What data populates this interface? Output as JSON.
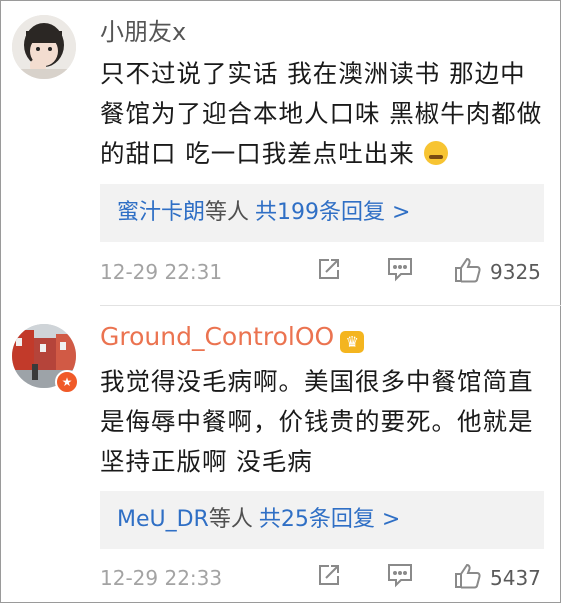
{
  "comments": [
    {
      "username": "小朋友x",
      "text": "只不过说了实话 我在澳洲读书 那边中餐馆为了迎合本地人口味 黑椒牛肉都做的甜口 吃一口我差点吐出来",
      "replies": {
        "users": "蜜汁卡朗",
        "suffix": "等人",
        "count": "共199条回复 >"
      },
      "timestamp": "12-29 22:31",
      "likes": "9325"
    },
    {
      "username": "Ground_ControlOO",
      "text": "我觉得没毛病啊。美国很多中餐馆简直是侮辱中餐啊，价钱贵的要死。他就是坚持正版啊 没毛病",
      "replies": {
        "users": "MeU_DR",
        "suffix": "等人",
        "count": "共25条回复 >"
      },
      "timestamp": "12-29 22:33",
      "likes": "5437"
    }
  ],
  "colors": {
    "link": "#2f6fc5",
    "vip_username": "#eb7350",
    "muted": "#a3a3a3",
    "reply_bg": "#f2f2f2"
  },
  "icons": [
    "share-icon",
    "comment-icon",
    "like-icon",
    "crown-icon",
    "emoji-icon"
  ]
}
